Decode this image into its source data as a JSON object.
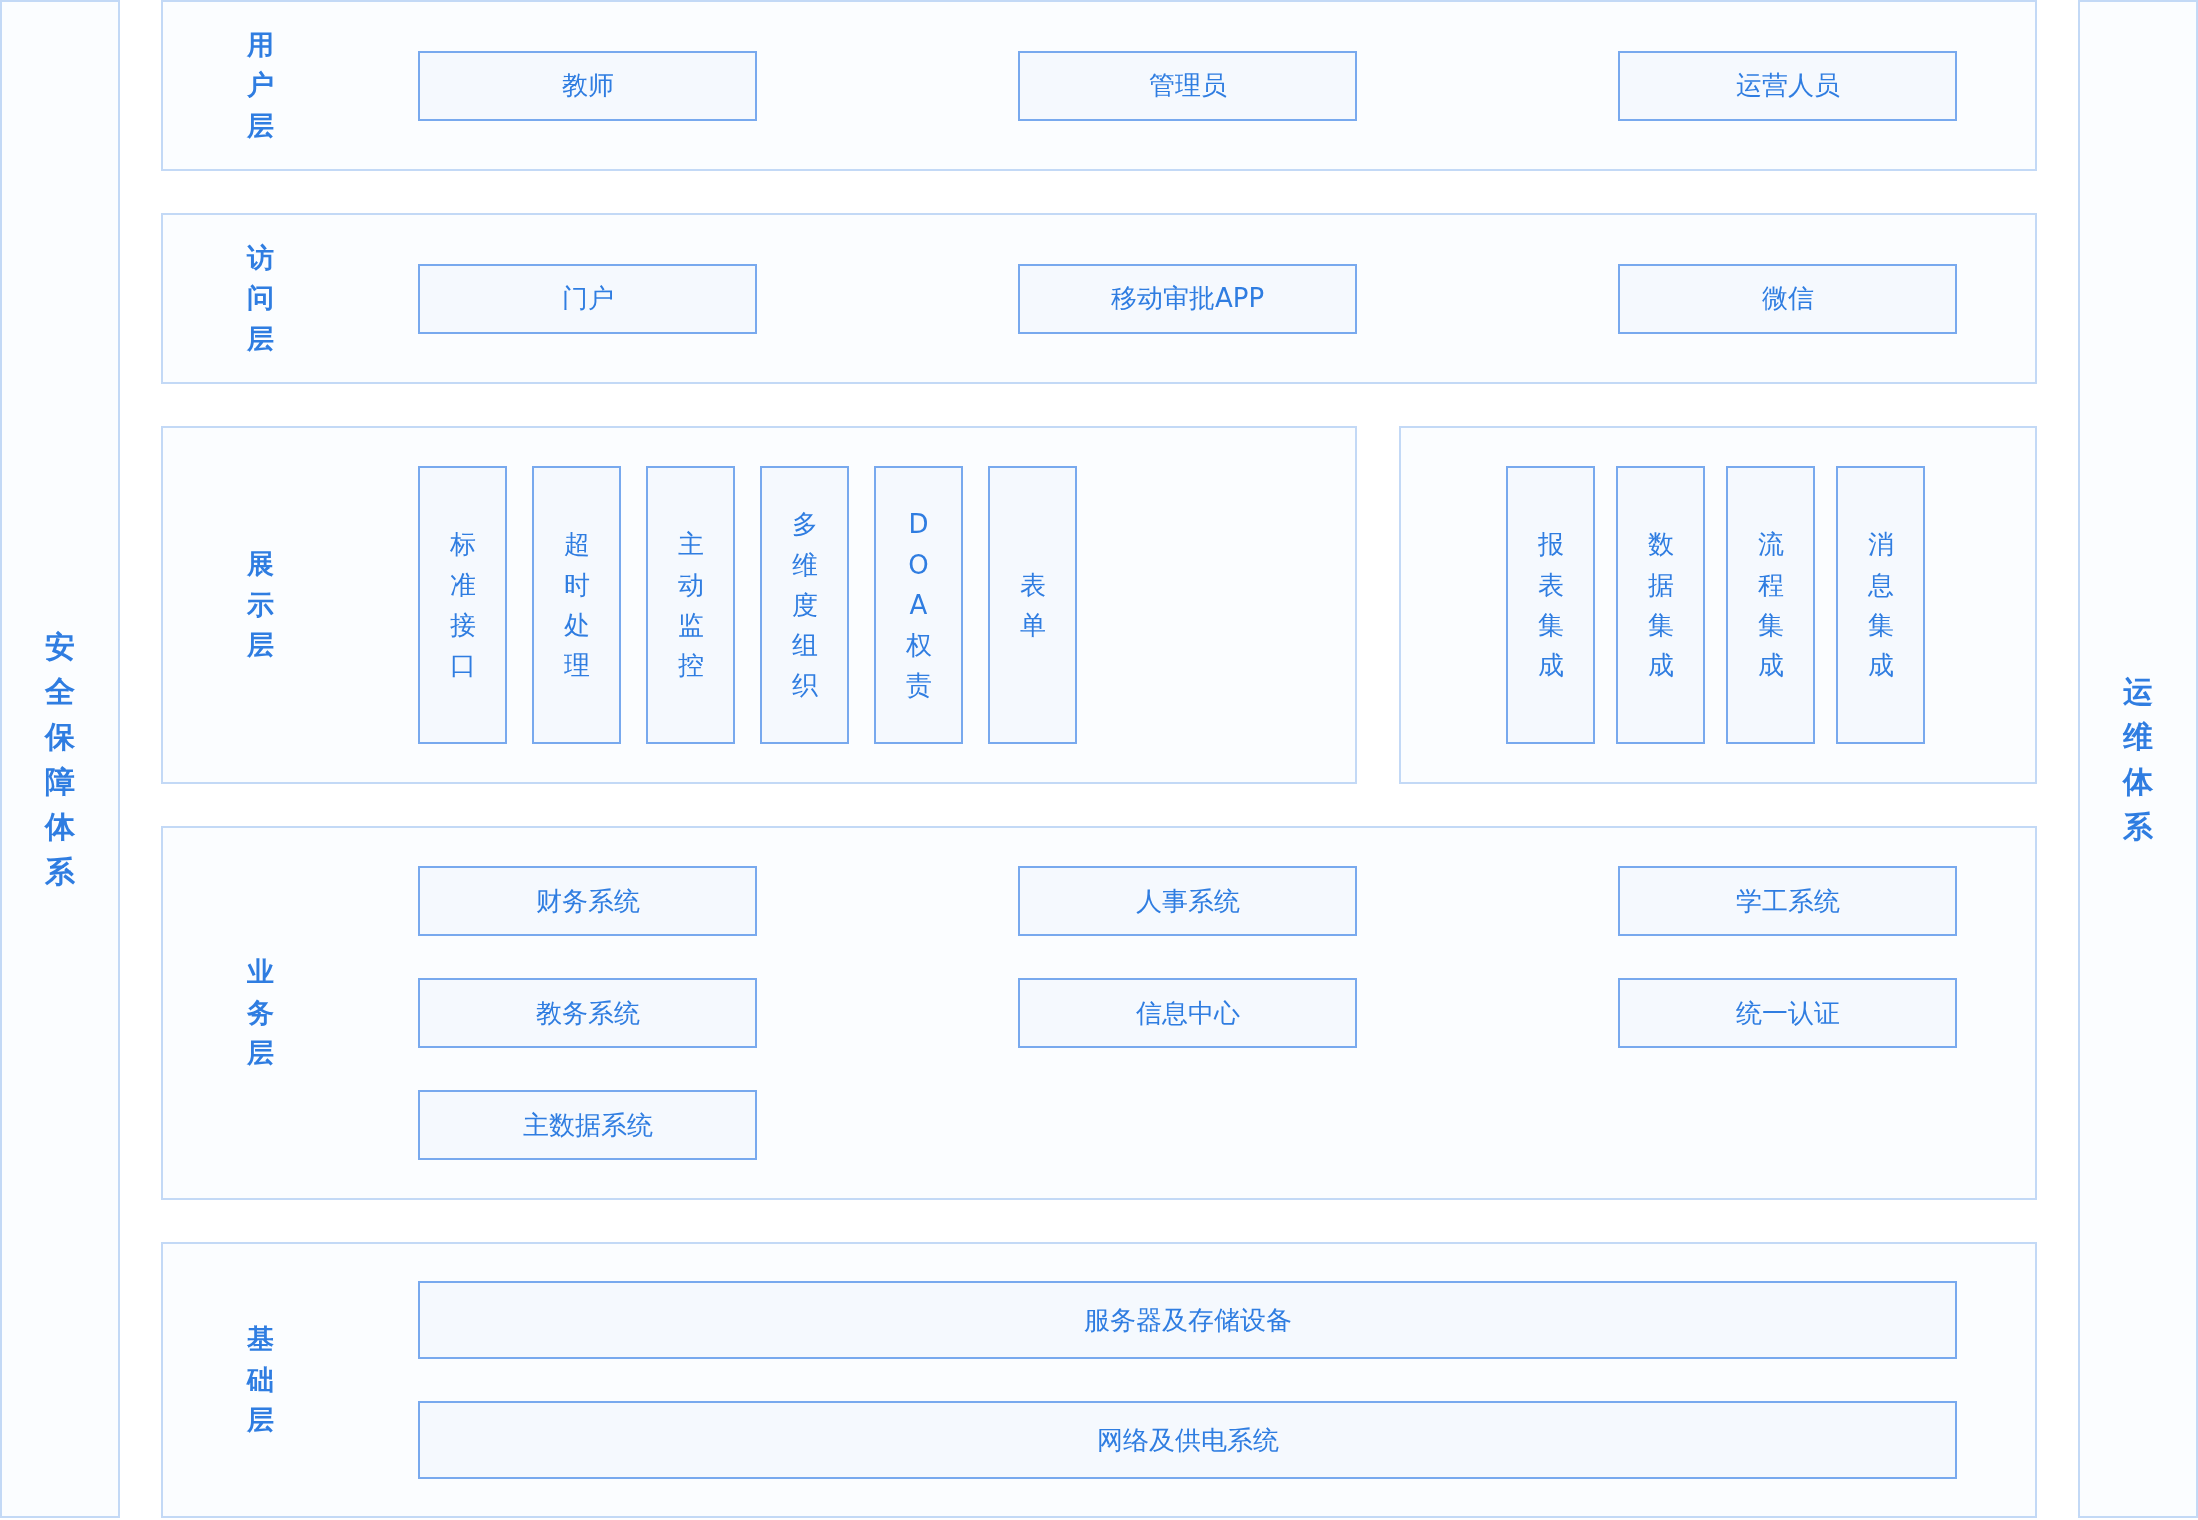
{
  "left_column": {
    "title": "安全保障体系"
  },
  "right_column": {
    "title": "运维体系"
  },
  "layers": [
    {
      "kind": "grid",
      "label": "用户层",
      "items": [
        "教师",
        "管理员",
        "运营人员"
      ]
    },
    {
      "kind": "grid",
      "label": "访问层",
      "items": [
        "门户",
        "移动审批APP",
        "微信"
      ]
    },
    {
      "kind": "vertical",
      "label": "展示层",
      "items": [
        "标准接口",
        "超时处理",
        "主动监控",
        "多维度组织",
        "DOA权责",
        "表单"
      ],
      "side_items": [
        "报表集成",
        "数据集成",
        "流程集成",
        "消息集成"
      ]
    },
    {
      "kind": "grid",
      "label": "业务层",
      "items": [
        "财务系统",
        "人事系统",
        "学工系统",
        "教务系统",
        "信息中心",
        "统一认证",
        "主数据系统"
      ]
    },
    {
      "kind": "wide",
      "label": "基础层",
      "items": [
        "服务器及存储设备",
        "网络及供电系统"
      ]
    }
  ]
}
